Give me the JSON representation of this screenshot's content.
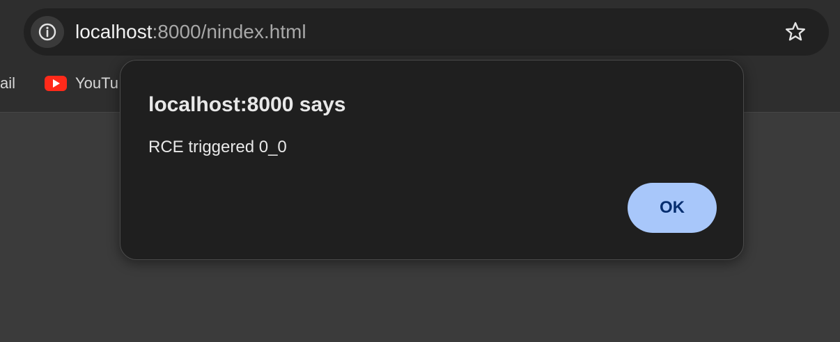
{
  "address_bar": {
    "url_host": "localhost",
    "url_rest": ":8000/nindex.html",
    "site_info_icon": "info-icon",
    "bookmark_icon": "star-icon"
  },
  "bookmarks_bar": {
    "items": [
      {
        "label": "ail",
        "icon": "gmail-icon"
      },
      {
        "label": "YouTu",
        "icon": "youtube-icon",
        "icon_color": "#ff2a1a"
      }
    ]
  },
  "alert_dialog": {
    "title": "localhost:8000 says",
    "message": "RCE triggered 0_0",
    "ok_label": "OK",
    "ok_color": "#a8c7fa"
  }
}
